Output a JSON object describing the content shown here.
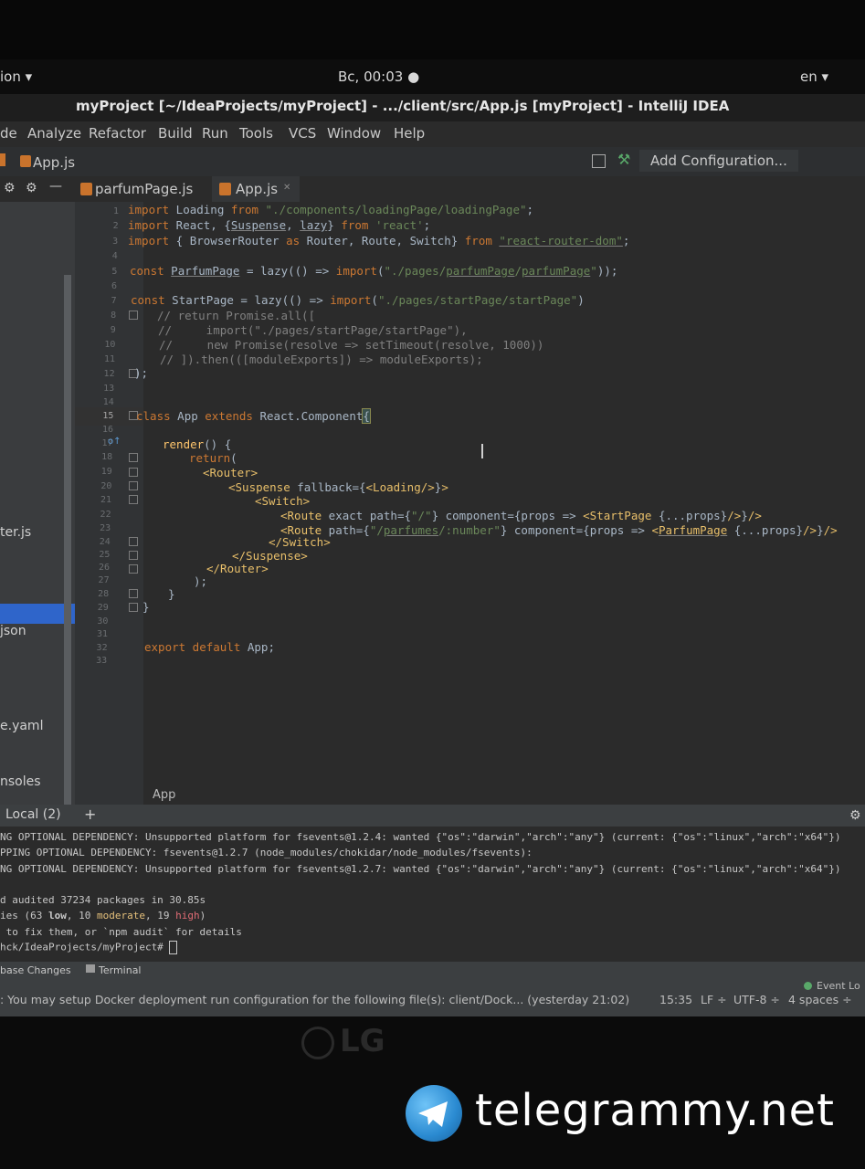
{
  "os_panel": {
    "app_menu": "ion ▾",
    "clock": "Вс, 00:03 ●",
    "language": "en ▾"
  },
  "window_title": "myProject [~/IdeaProjects/myProject] - .../client/src/App.js [myProject] - IntelliJ IDEA",
  "menu": [
    "de",
    "Analyze",
    "Refactor",
    "Build",
    "Run",
    "Tools",
    "VCS",
    "Window",
    "Help"
  ],
  "navbar": {
    "breadcrumb_file": "App.js",
    "run_config": "Add Configuration..."
  },
  "tabs": [
    {
      "label": "parfumPage.js",
      "active": false
    },
    {
      "label": "App.js",
      "active": true
    }
  ],
  "project_tree": [
    "ter.js",
    "json",
    "e.yaml",
    "nsoles"
  ],
  "line_numbers": [
    "1",
    "2",
    "3",
    "4",
    "5",
    "6",
    "7",
    "8",
    "9",
    "10",
    "11",
    "12",
    "13",
    "14",
    "15",
    "16",
    "17",
    "18",
    "19",
    "20",
    "21",
    "22",
    "23",
    "24",
    "25",
    "26",
    "27",
    "28",
    "29",
    "30",
    "31",
    "32",
    "33"
  ],
  "current_line": "15",
  "breadcrumb": "App",
  "terminal": {
    "tab_label": "Local (2)",
    "add_tab": "+",
    "lines": [
      "NG OPTIONAL DEPENDENCY: Unsupported platform for fsevents@1.2.4: wanted {\"os\":\"darwin\",\"arch\":\"any\"} (current: {\"os\":\"linux\",\"arch\":\"x64\"})",
      "PPING OPTIONAL DEPENDENCY: fsevents@1.2.7 (node_modules/chokidar/node_modules/fsevents):",
      "NG OPTIONAL DEPENDENCY: Unsupported platform for fsevents@1.2.7: wanted {\"os\":\"darwin\",\"arch\":\"any\"} (current: {\"os\":\"linux\",\"arch\":\"x64\"})",
      "",
      "d audited 37234 packages in 30.85s"
    ],
    "vuln_prefix": "ies (63 ",
    "low": "low",
    "sep1": ", 10 ",
    "moderate": "moderate",
    "sep2": ", 19 ",
    "high": "high",
    "vuln_suffix": ")",
    "fix_line": " to fix them, or `npm audit` for details",
    "prompt": "hck/IdeaProjects/myProject# "
  },
  "bottom_tabs": [
    "base Changes",
    "Terminal"
  ],
  "status": {
    "message": ": You may setup Docker deployment run configuration for the following file(s): client/Dock... (yesterday 21:02)",
    "event_log": "Event Lo",
    "position": "15:35",
    "line_sep": "LF ÷",
    "encoding": "UTF-8 ÷",
    "indent": "4 spaces ÷"
  },
  "monitor_brand": "LG",
  "watermark": "telegrammy.net",
  "colors": {
    "editor_bg": "#2b2b2b",
    "keyword": "#cc7832",
    "string": "#6a8759",
    "comment": "#808080",
    "tag": "#e8bf6a",
    "accent": "#4a88c7"
  }
}
